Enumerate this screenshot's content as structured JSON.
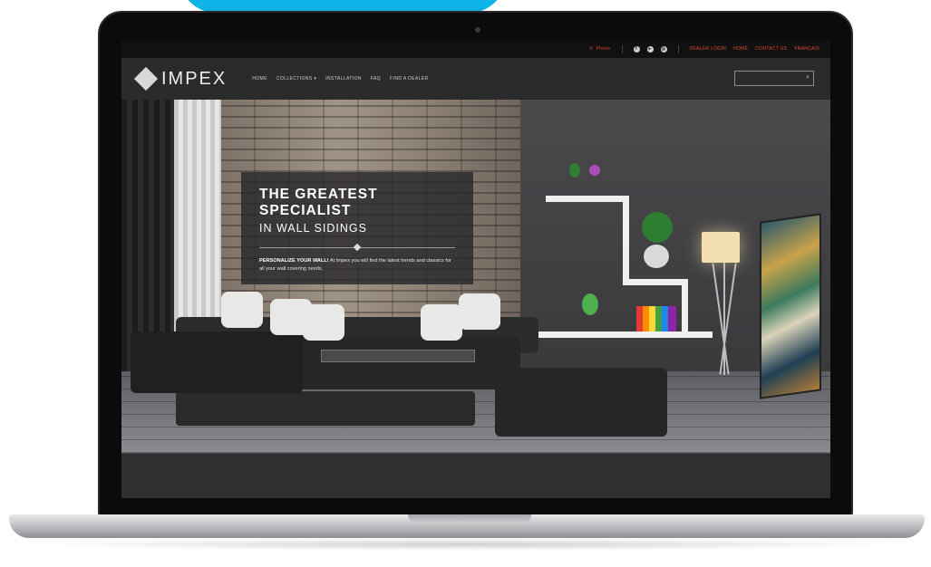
{
  "utility_bar": {
    "phone": "Phone",
    "social_icons": [
      "facebook-icon",
      "youtube-icon",
      "instagram-icon"
    ],
    "links": [
      "DEALER LOGIN",
      "HOME",
      "CONTACT US",
      "FRANÇAIS"
    ]
  },
  "nav": {
    "logo_text": "IMPEX",
    "menu": [
      "HOME",
      "COLLECTIONS ▾",
      "INSTALLATION",
      "FAQ",
      "FIND A DEALER"
    ],
    "search_placeholder": ""
  },
  "hero": {
    "title": "THE GREATEST SPECIALIST",
    "subtitle": "IN WALL SIDINGS",
    "body_bold": "PERSONALIZE YOUR WALL!",
    "body_text": " At Impex you will find the latest trends and classics for all your wall covering needs."
  },
  "colors": {
    "accent": "#e2482d",
    "top_tab": "#10b3e8",
    "nav_bg": "#2b2b2c"
  }
}
